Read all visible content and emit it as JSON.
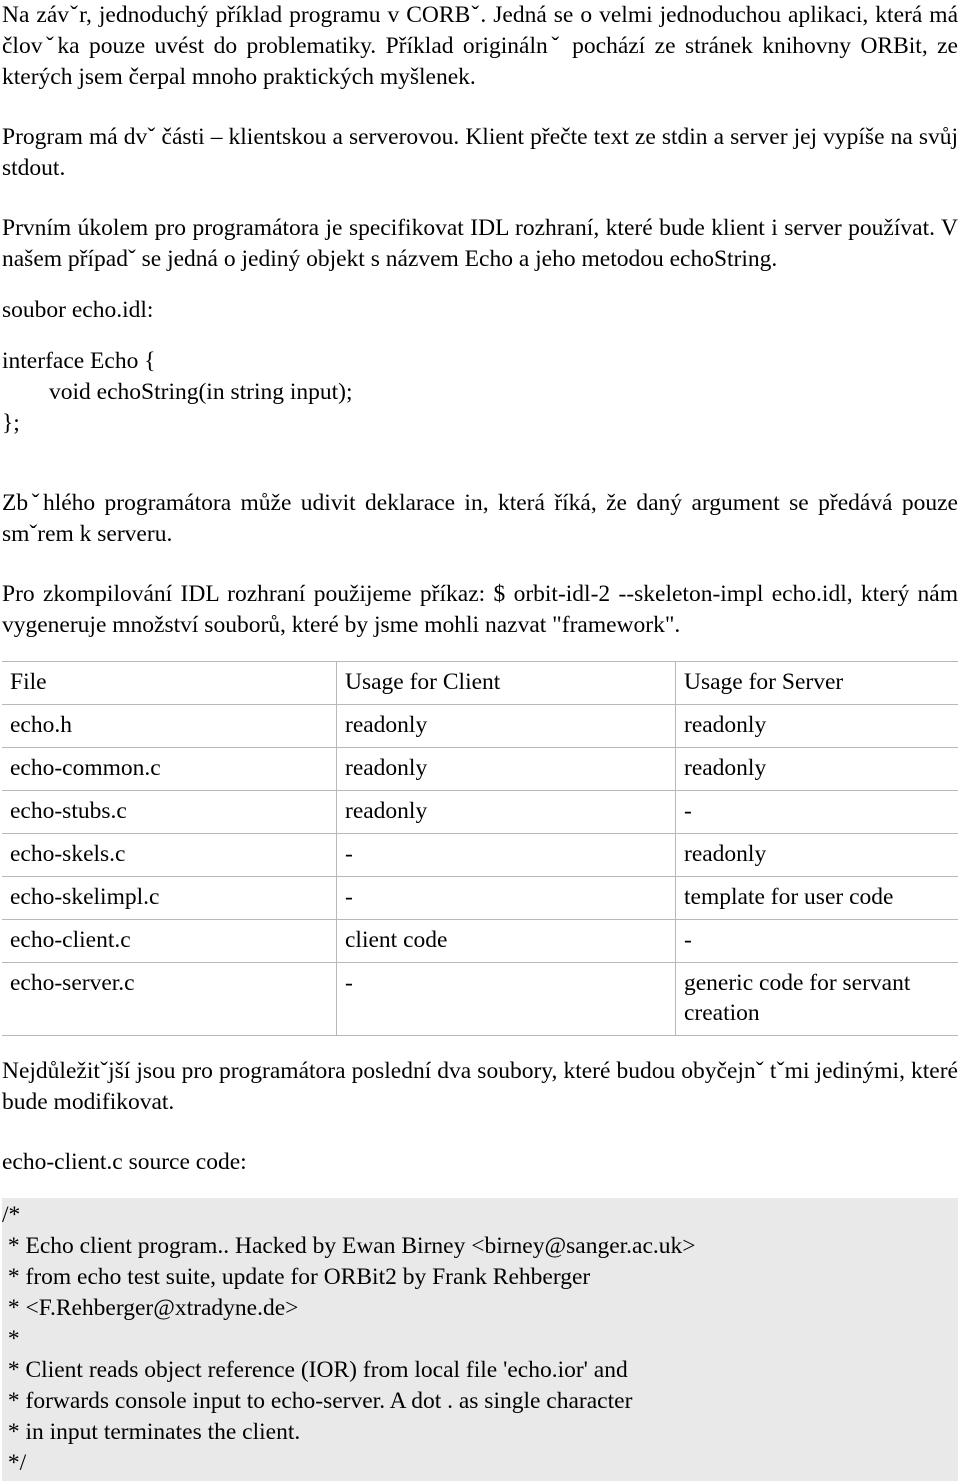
{
  "document": {
    "paragraphs": {
      "intro": "Na závˇr, jednoduchý příklad programu v CORBˇ. Jedná se o velmi jednoduchou aplikaci, která má človˇka pouze uvést do problematiky. Příklad originálnˇ pochází ze stránek knihovny ORBit, ze kterých jsem čerpal mnoho praktických myšlenek.",
      "program_parts": "Program má dvˇ části – klientskou a serverovou. Klient přečte text ze stdin a server jej vypíše na svůj stdout.",
      "first_task": "Prvním úkolem pro programátora je specifikovat IDL rozhraní, které bude klient i server používat. V našem případˇ se jedná o jediný objekt s názvem Echo a jeho metodou echoString.",
      "idl_file_label": "soubor echo.idl:",
      "in_declaration": "Zbˇhlého programátora může udivit deklarace in, která říká, že daný argument se předává pouze smˇrem k serveru.",
      "compile": "Pro zkompilování IDL rozhraní použijeme příkaz: $ orbit-idl-2 --skeleton-impl echo.idl, který nám vygeneruje množství souborů, které by jsme mohli nazvat \"framework\".",
      "most_important": "Nejdůležitˇjší jsou pro programátora poslední dva soubory, které budou obyčejnˇ tˇmi jedinými, které bude modifikovat.",
      "source_label": "echo-client.c source code:"
    },
    "idl_code": "interface Echo {\n        void echoString(in string input);\n};",
    "files_table": {
      "headers": [
        "File",
        "Usage for Client",
        "Usage for Server"
      ],
      "rows": [
        {
          "file": "echo.h",
          "client": "readonly",
          "server": "readonly"
        },
        {
          "file": "echo-common.c",
          "client": "readonly",
          "server": "readonly"
        },
        {
          "file": "echo-stubs.c",
          "client": "readonly",
          "server": "-"
        },
        {
          "file": "echo-skels.c",
          "client": "-",
          "server": "readonly"
        },
        {
          "file": "echo-skelimpl.c",
          "client": "-",
          "server": "template for user code"
        },
        {
          "file": "echo-client.c",
          "client": "client code",
          "server": "-"
        },
        {
          "file": "echo-server.c",
          "client": "-",
          "server": "generic code for servant creation"
        }
      ]
    },
    "client_source_comment": "/*\n * Echo client program.. Hacked by Ewan Birney <birney@sanger.ac.uk>\n * from echo test suite, update for ORBit2 by Frank Rehberger\n * <F.Rehberger@xtradyne.de>\n *\n * Client reads object reference (IOR) from local file 'echo.ior' and\n * forwards console input to echo-server. A dot . as single character\n * in input terminates the client.\n */"
  }
}
